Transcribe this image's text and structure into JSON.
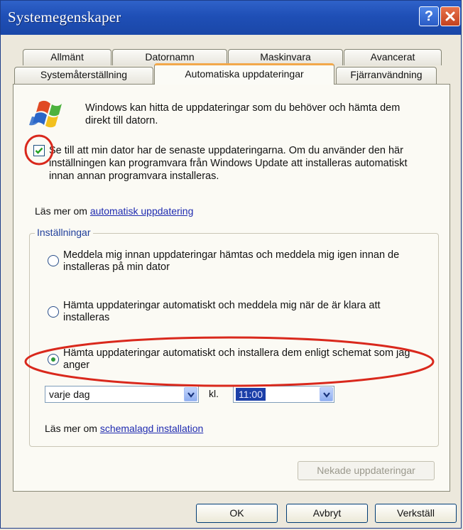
{
  "window": {
    "title": "Systemegenskaper",
    "help_label": "?",
    "close_label": "✕"
  },
  "tabs": {
    "row1": [
      "Allmänt",
      "Datornamn",
      "Maskinvara",
      "Avancerat"
    ],
    "row2": [
      "Systemåterställning",
      "Automatiska uppdateringar",
      "Fjärranvändning"
    ],
    "active": "Automatiska uppdateringar"
  },
  "intro_text": "Windows kan hitta de uppdateringar som du behöver och hämta dem direkt till datorn.",
  "keep_updated": {
    "checked": true,
    "text": "Se till att min dator har de senaste uppdateringarna. Om du använder den här inställningen kan programvara från Windows Update att installeras automatiskt innan annan programvara installeras."
  },
  "learn_more": {
    "prefix": "Läs mer om ",
    "link": "automatisk uppdatering"
  },
  "settings": {
    "legend": "Inställningar",
    "options": [
      {
        "label": "Meddela mig innan uppdateringar hämtas och meddela mig igen innan de installeras på min dator",
        "selected": false
      },
      {
        "label": "Hämta uppdateringar automatiskt och meddela mig när de är klara att installeras",
        "selected": false
      },
      {
        "label": "Hämta uppdateringar automatiskt och installera dem enligt schemat som jag anger",
        "selected": true
      }
    ],
    "schedule_day": "varje dag",
    "time_label": "kl.",
    "schedule_time": "11:00",
    "learn_prefix": "Läs mer om ",
    "learn_link": "schemalagd installation",
    "declined_button": "Nekade uppdateringar"
  },
  "buttons": {
    "ok": "OK",
    "cancel": "Avbryt",
    "apply": "Verkställ"
  },
  "colors": {
    "titlebar": "#2358c1",
    "annotation": "#d9281c",
    "selection": "#1b3fa8"
  }
}
